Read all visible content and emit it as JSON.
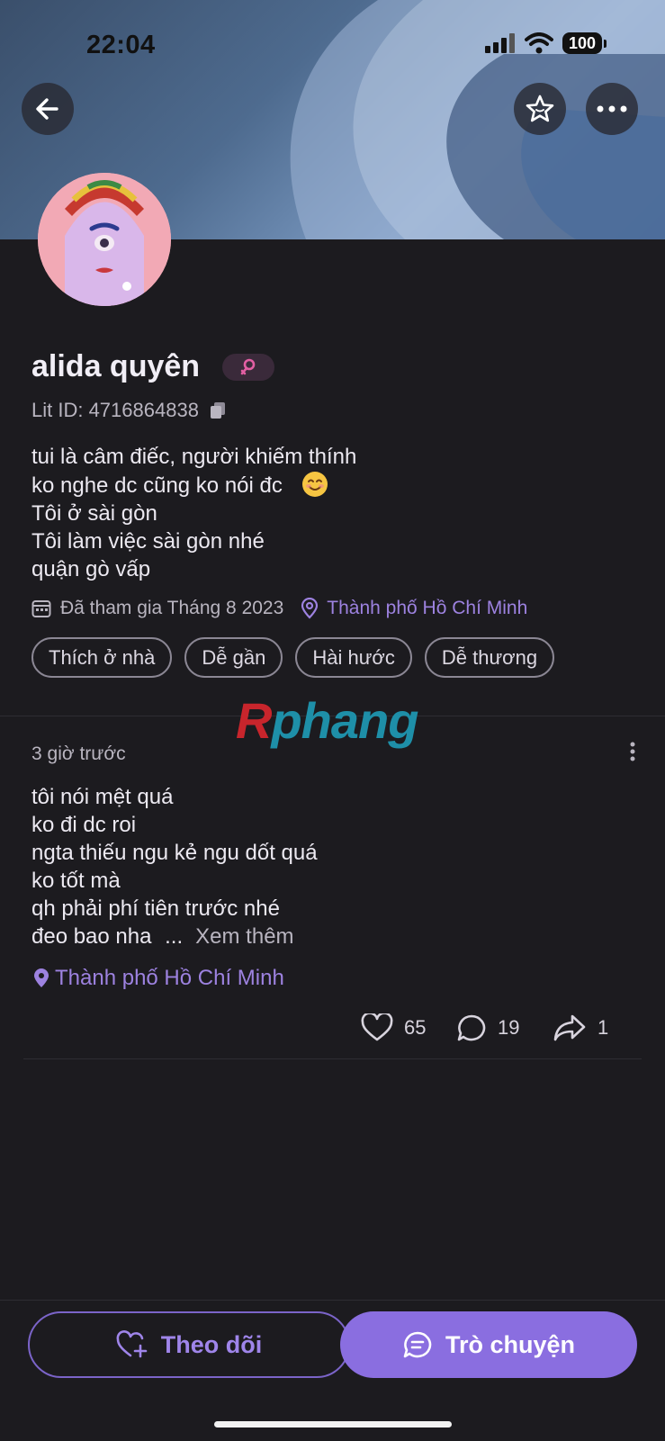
{
  "status_bar": {
    "time": "22:04",
    "battery": "100"
  },
  "profile": {
    "name": "alida quyên",
    "lit_id": "Lit ID: 4716864838",
    "bio_lines": [
      "tui là câm điếc, người khiếm thính",
      "ko nghe dc cũng ko nói đc",
      "Tôi ở sài gòn",
      "Tôi làm việc sài gòn nhé",
      "quận gò vấp"
    ],
    "joined": "Đã tham gia Tháng 8 2023",
    "location": "Thành phố Hồ Chí Minh",
    "tags": [
      "Thích ở nhà",
      "Dễ gần",
      "Hài hước",
      "Dễ thương"
    ]
  },
  "watermark": {
    "first": "R",
    "rest": "phang"
  },
  "post": {
    "time": "3 giờ trước",
    "lines": [
      "tôi nói mệt quá",
      "ko đi dc roi",
      "ngta thiếu ngu kẻ ngu dốt quá",
      "ko tốt mà",
      "qh phải phí tiên trước nhé",
      "đeo bao nha"
    ],
    "ellipsis": "...",
    "see_more": "Xem thêm",
    "location": "Thành phố Hồ Chí Minh",
    "likes": "65",
    "comments": "19",
    "shares": "1"
  },
  "buttons": {
    "follow": "Theo dõi",
    "chat": "Trò chuyện"
  },
  "colors": {
    "accent": "#8a6ee0",
    "background": "#1c1b1f",
    "location": "#9d82e0"
  }
}
